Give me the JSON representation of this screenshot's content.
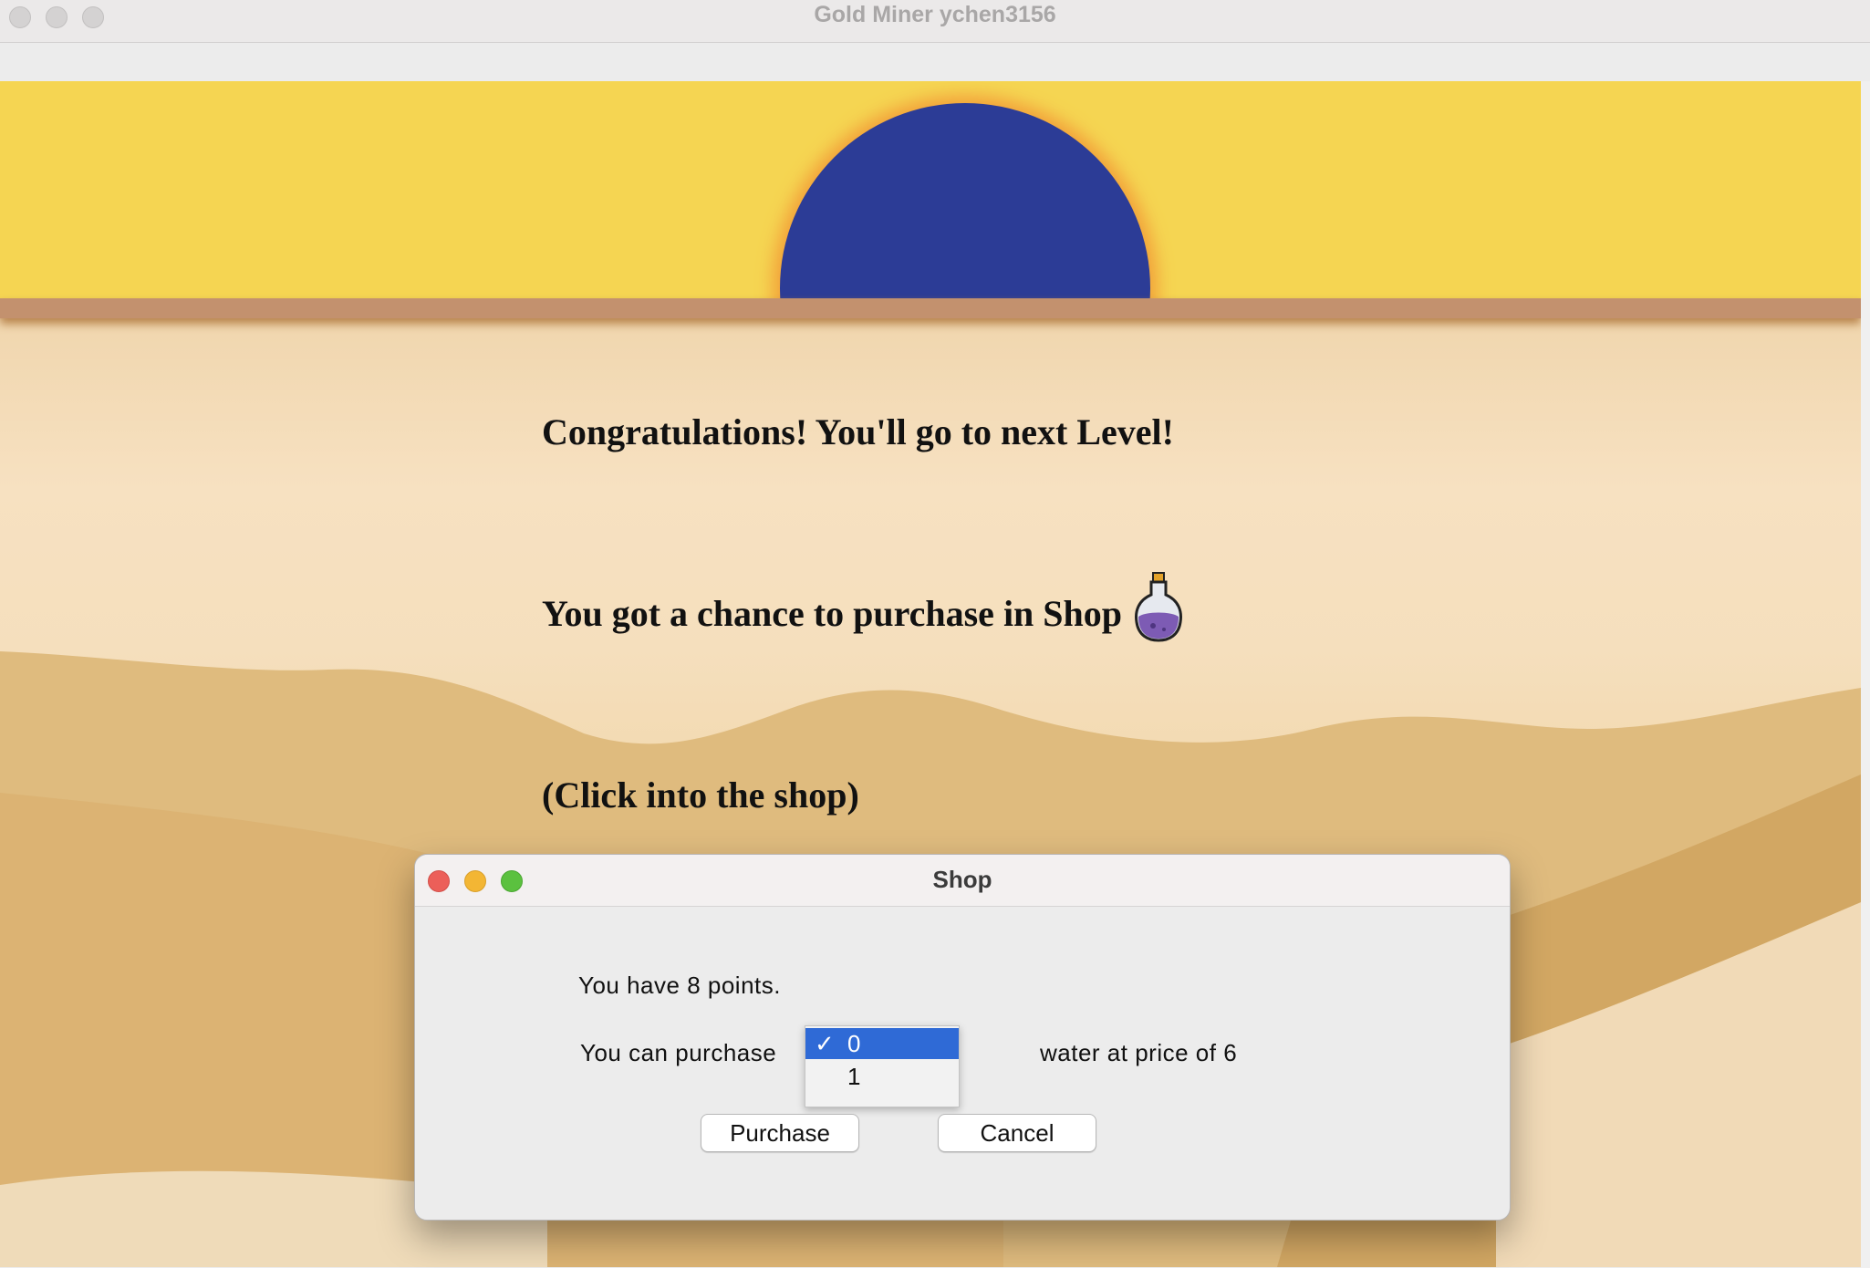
{
  "window": {
    "title": "Gold Miner ychen3156"
  },
  "game": {
    "messages": [
      "Congratulations! You'll go to next Level!",
      "You got a chance to purchase in Shop",
      "(Click into the shop)"
    ],
    "icons": {
      "sun": "sun-icon",
      "potion": "potion-icon"
    },
    "colors": {
      "sky": "#f5d552",
      "sun": "#2c3c96",
      "sand": "#e3b870"
    }
  },
  "shop_dialog": {
    "title": "Shop",
    "points_text": "You have 8 points.",
    "purchase_prefix": "You can purchase",
    "purchase_suffix": "water at price of 6",
    "quantity_options": [
      {
        "value": "0",
        "selected": true
      },
      {
        "value": "1",
        "selected": false
      }
    ],
    "check_mark": "✓",
    "purchase_button": "Purchase",
    "cancel_button": "Cancel",
    "colors": {
      "selection": "#2f6ad6",
      "close": "#ec5f59",
      "minimize": "#f3b634",
      "maximize": "#5bc13f"
    }
  }
}
